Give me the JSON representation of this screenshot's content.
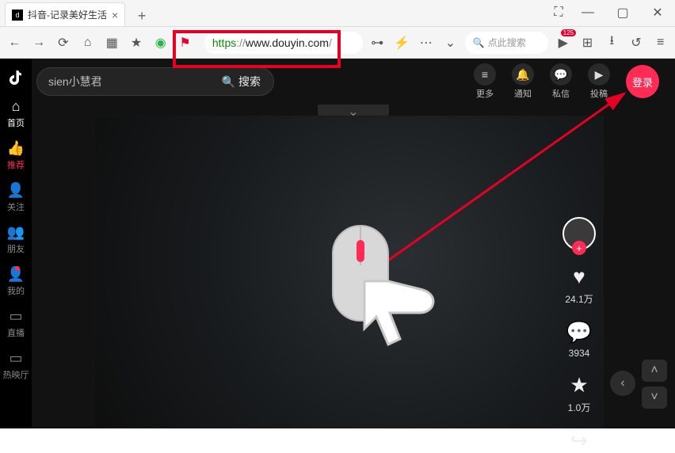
{
  "browser": {
    "tab_title": "抖音-记录美好生活",
    "url_https": "https",
    "url_sep": "://",
    "url_host": "www.douyin.com",
    "url_trail": "/",
    "search_placeholder": "点此搜索",
    "ext_badge": "125"
  },
  "app": {
    "logo_glyph": "♪",
    "search_text": "sien小慧君",
    "search_button": "搜索",
    "sidebar": {
      "home": "首页",
      "recommend": "推荐",
      "follow": "关注",
      "friends": "朋友",
      "mine": "我的",
      "live": "直播",
      "hot": "热映厅"
    },
    "top_actions": {
      "more": "更多",
      "notice": "通知",
      "msg": "私信",
      "upload": "投稿",
      "login": "登录"
    },
    "rail": {
      "likes": "24.1万",
      "comments": "3934",
      "favorites": "1.0万"
    }
  }
}
